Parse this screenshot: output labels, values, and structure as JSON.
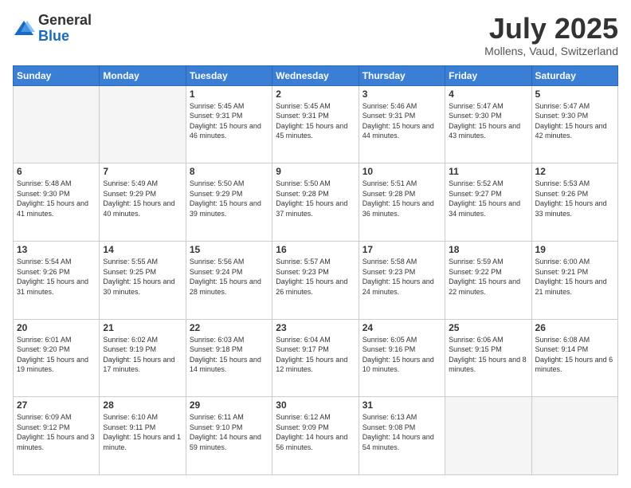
{
  "logo": {
    "general": "General",
    "blue": "Blue"
  },
  "title": {
    "month_year": "July 2025",
    "location": "Mollens, Vaud, Switzerland"
  },
  "headers": [
    "Sunday",
    "Monday",
    "Tuesday",
    "Wednesday",
    "Thursday",
    "Friday",
    "Saturday"
  ],
  "weeks": [
    [
      {
        "day": "",
        "empty": true
      },
      {
        "day": "",
        "empty": true
      },
      {
        "day": "1",
        "sunrise": "5:45 AM",
        "sunset": "9:31 PM",
        "daylight": "15 hours and 46 minutes."
      },
      {
        "day": "2",
        "sunrise": "5:45 AM",
        "sunset": "9:31 PM",
        "daylight": "15 hours and 45 minutes."
      },
      {
        "day": "3",
        "sunrise": "5:46 AM",
        "sunset": "9:31 PM",
        "daylight": "15 hours and 44 minutes."
      },
      {
        "day": "4",
        "sunrise": "5:47 AM",
        "sunset": "9:30 PM",
        "daylight": "15 hours and 43 minutes."
      },
      {
        "day": "5",
        "sunrise": "5:47 AM",
        "sunset": "9:30 PM",
        "daylight": "15 hours and 42 minutes."
      }
    ],
    [
      {
        "day": "6",
        "sunrise": "5:48 AM",
        "sunset": "9:30 PM",
        "daylight": "15 hours and 41 minutes."
      },
      {
        "day": "7",
        "sunrise": "5:49 AM",
        "sunset": "9:29 PM",
        "daylight": "15 hours and 40 minutes."
      },
      {
        "day": "8",
        "sunrise": "5:50 AM",
        "sunset": "9:29 PM",
        "daylight": "15 hours and 39 minutes."
      },
      {
        "day": "9",
        "sunrise": "5:50 AM",
        "sunset": "9:28 PM",
        "daylight": "15 hours and 37 minutes."
      },
      {
        "day": "10",
        "sunrise": "5:51 AM",
        "sunset": "9:28 PM",
        "daylight": "15 hours and 36 minutes."
      },
      {
        "day": "11",
        "sunrise": "5:52 AM",
        "sunset": "9:27 PM",
        "daylight": "15 hours and 34 minutes."
      },
      {
        "day": "12",
        "sunrise": "5:53 AM",
        "sunset": "9:26 PM",
        "daylight": "15 hours and 33 minutes."
      }
    ],
    [
      {
        "day": "13",
        "sunrise": "5:54 AM",
        "sunset": "9:26 PM",
        "daylight": "15 hours and 31 minutes."
      },
      {
        "day": "14",
        "sunrise": "5:55 AM",
        "sunset": "9:25 PM",
        "daylight": "15 hours and 30 minutes."
      },
      {
        "day": "15",
        "sunrise": "5:56 AM",
        "sunset": "9:24 PM",
        "daylight": "15 hours and 28 minutes."
      },
      {
        "day": "16",
        "sunrise": "5:57 AM",
        "sunset": "9:23 PM",
        "daylight": "15 hours and 26 minutes."
      },
      {
        "day": "17",
        "sunrise": "5:58 AM",
        "sunset": "9:23 PM",
        "daylight": "15 hours and 24 minutes."
      },
      {
        "day": "18",
        "sunrise": "5:59 AM",
        "sunset": "9:22 PM",
        "daylight": "15 hours and 22 minutes."
      },
      {
        "day": "19",
        "sunrise": "6:00 AM",
        "sunset": "9:21 PM",
        "daylight": "15 hours and 21 minutes."
      }
    ],
    [
      {
        "day": "20",
        "sunrise": "6:01 AM",
        "sunset": "9:20 PM",
        "daylight": "15 hours and 19 minutes."
      },
      {
        "day": "21",
        "sunrise": "6:02 AM",
        "sunset": "9:19 PM",
        "daylight": "15 hours and 17 minutes."
      },
      {
        "day": "22",
        "sunrise": "6:03 AM",
        "sunset": "9:18 PM",
        "daylight": "15 hours and 14 minutes."
      },
      {
        "day": "23",
        "sunrise": "6:04 AM",
        "sunset": "9:17 PM",
        "daylight": "15 hours and 12 minutes."
      },
      {
        "day": "24",
        "sunrise": "6:05 AM",
        "sunset": "9:16 PM",
        "daylight": "15 hours and 10 minutes."
      },
      {
        "day": "25",
        "sunrise": "6:06 AM",
        "sunset": "9:15 PM",
        "daylight": "15 hours and 8 minutes."
      },
      {
        "day": "26",
        "sunrise": "6:08 AM",
        "sunset": "9:14 PM",
        "daylight": "15 hours and 6 minutes."
      }
    ],
    [
      {
        "day": "27",
        "sunrise": "6:09 AM",
        "sunset": "9:12 PM",
        "daylight": "15 hours and 3 minutes."
      },
      {
        "day": "28",
        "sunrise": "6:10 AM",
        "sunset": "9:11 PM",
        "daylight": "15 hours and 1 minute."
      },
      {
        "day": "29",
        "sunrise": "6:11 AM",
        "sunset": "9:10 PM",
        "daylight": "14 hours and 59 minutes."
      },
      {
        "day": "30",
        "sunrise": "6:12 AM",
        "sunset": "9:09 PM",
        "daylight": "14 hours and 56 minutes."
      },
      {
        "day": "31",
        "sunrise": "6:13 AM",
        "sunset": "9:08 PM",
        "daylight": "14 hours and 54 minutes."
      },
      {
        "day": "",
        "empty": true
      },
      {
        "day": "",
        "empty": true
      }
    ]
  ],
  "labels": {
    "sunrise_prefix": "Sunrise: ",
    "sunset_prefix": "Sunset: ",
    "daylight_prefix": "Daylight: "
  }
}
